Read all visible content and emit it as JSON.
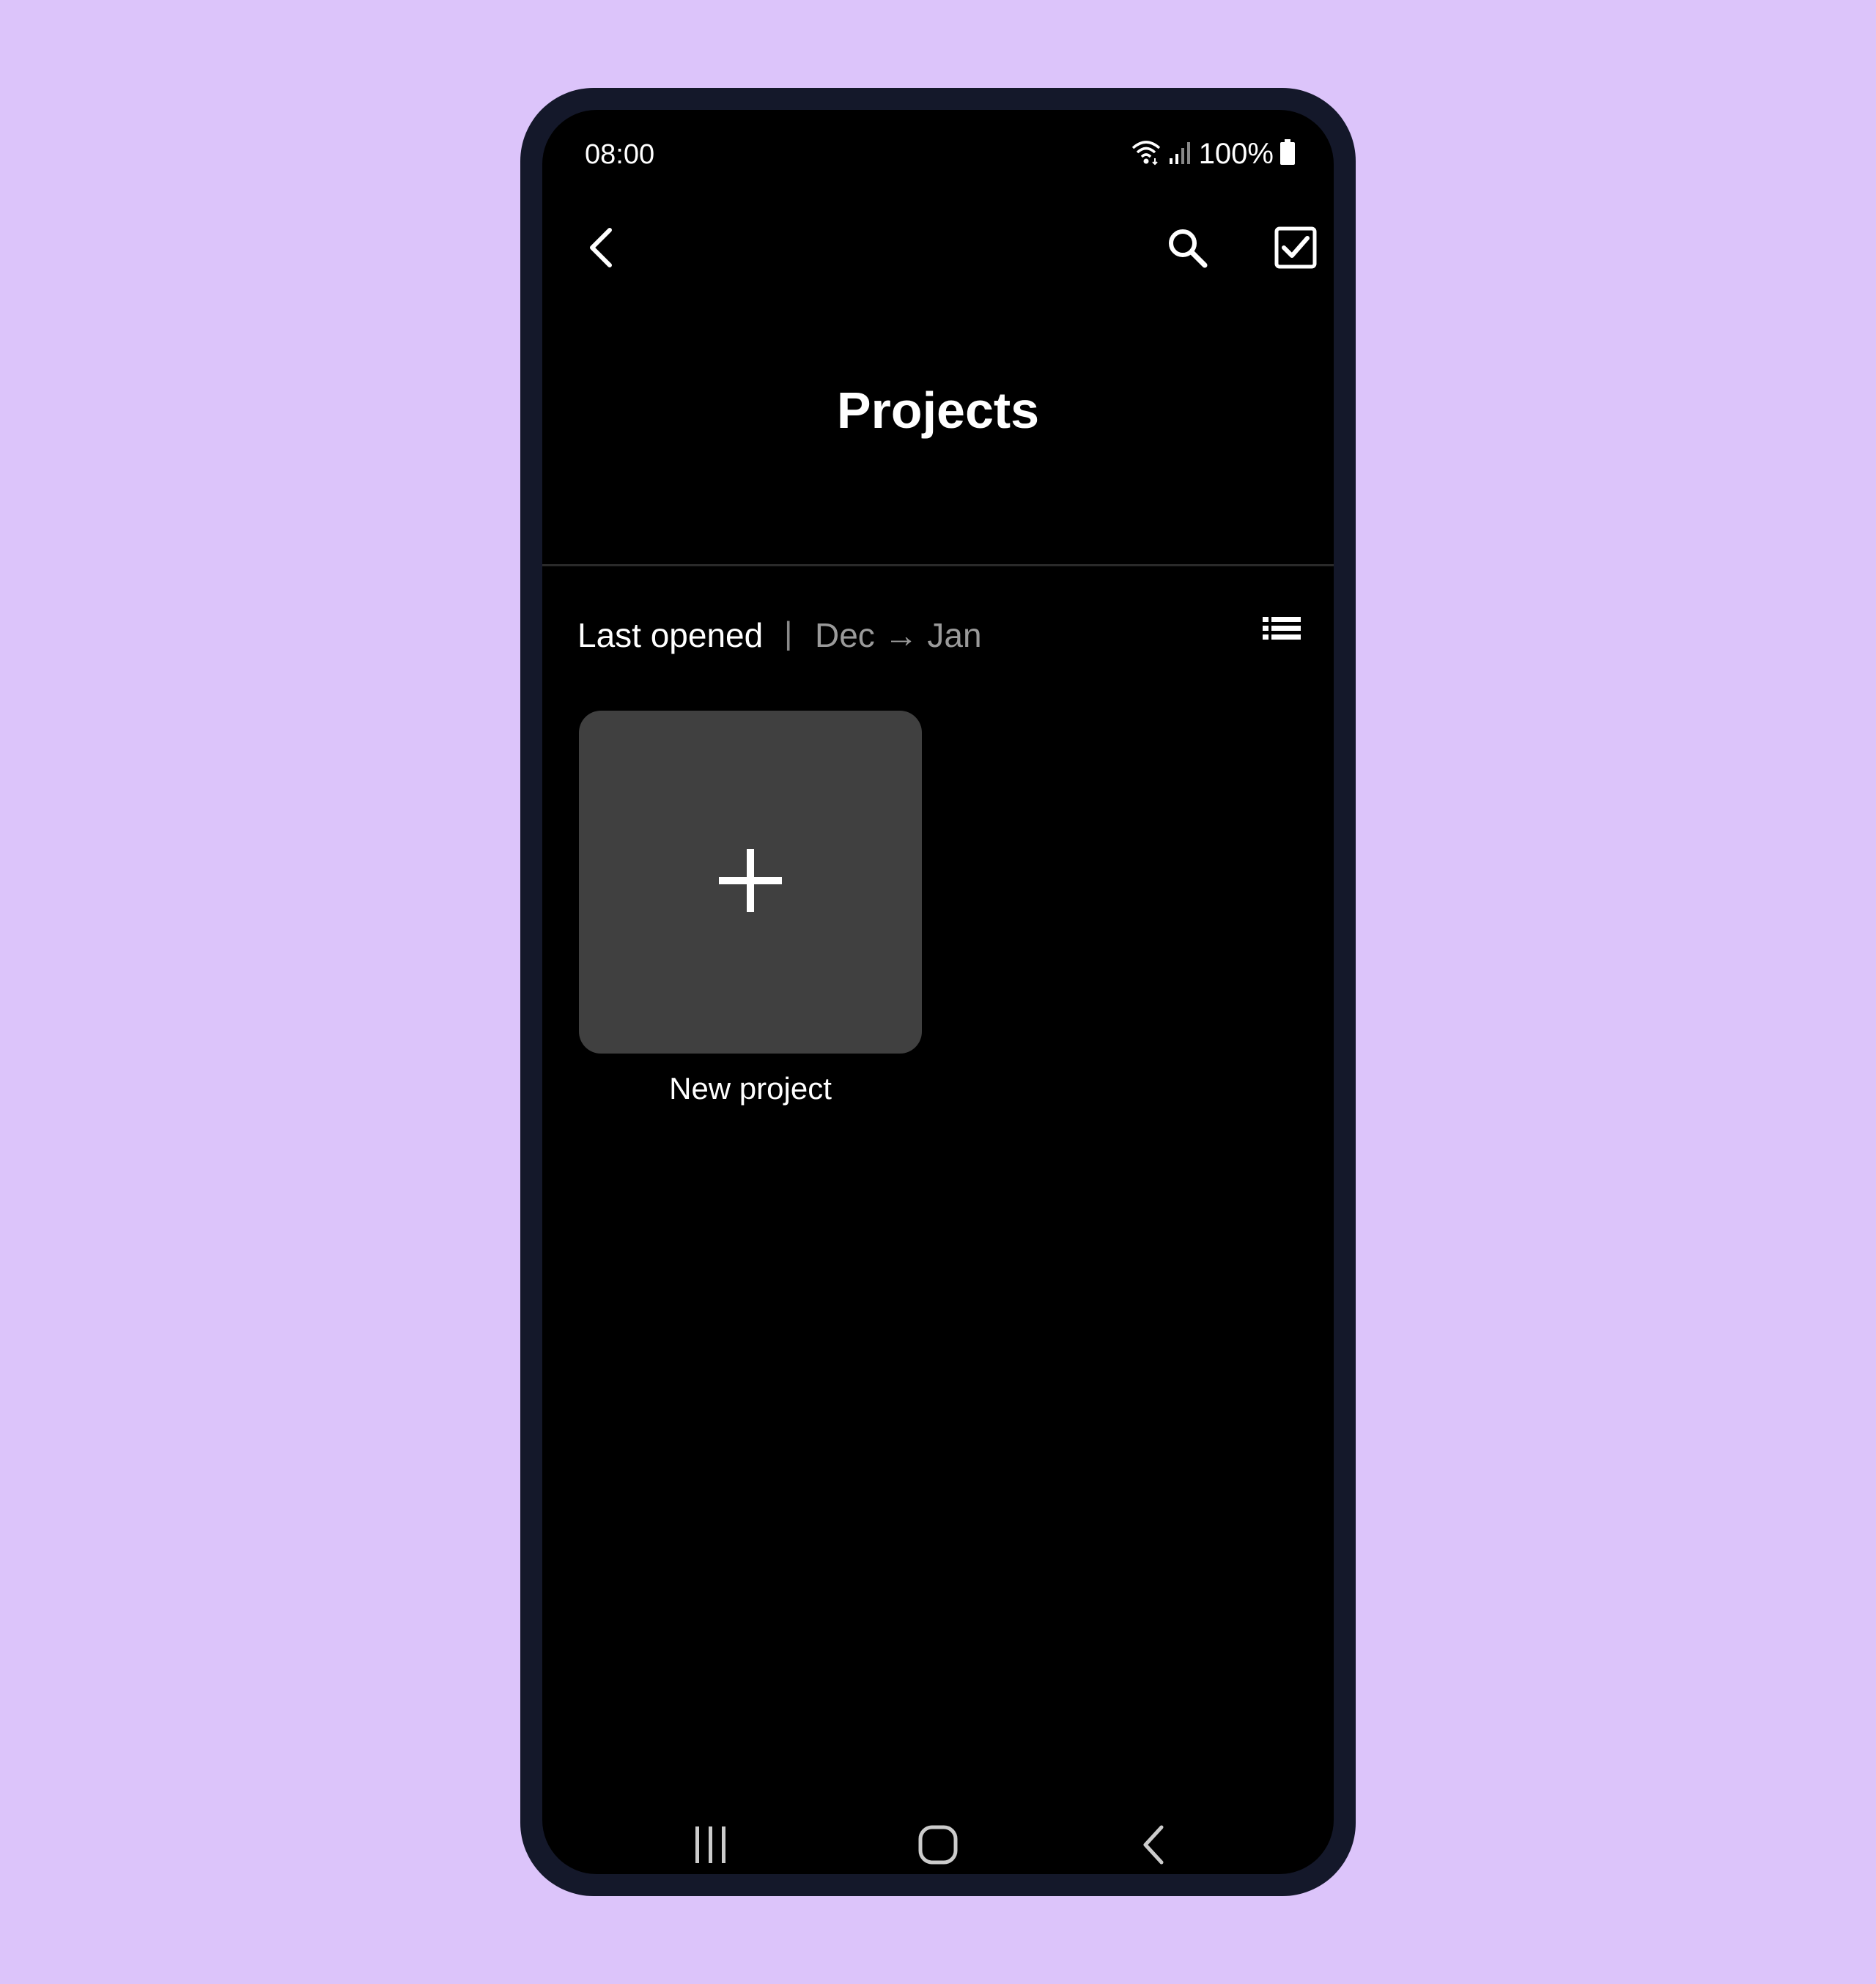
{
  "status_bar": {
    "time": "08:00",
    "battery": "100%",
    "icons": [
      "wifi-icon",
      "signal-icon",
      "battery-icon"
    ]
  },
  "toolbar": {
    "icons": [
      "back-arrow-icon",
      "search-icon",
      "select-checkbox-icon"
    ]
  },
  "page": {
    "title": "Projects"
  },
  "sort": {
    "label": "Last opened",
    "separator": "|",
    "order": "Dec → Jan",
    "view_icon": "list-view-icon"
  },
  "projects": [
    {
      "label": "New project",
      "icon": "plus-icon"
    }
  ],
  "navigation_bar": {
    "icons": [
      "recents-icon",
      "home-icon",
      "back-icon"
    ]
  },
  "colors": {
    "background": "#dcc4fa",
    "device_frame": "#14182a",
    "screen": "#000000",
    "tile": "#404040",
    "muted_text": "#9a9a9a"
  }
}
